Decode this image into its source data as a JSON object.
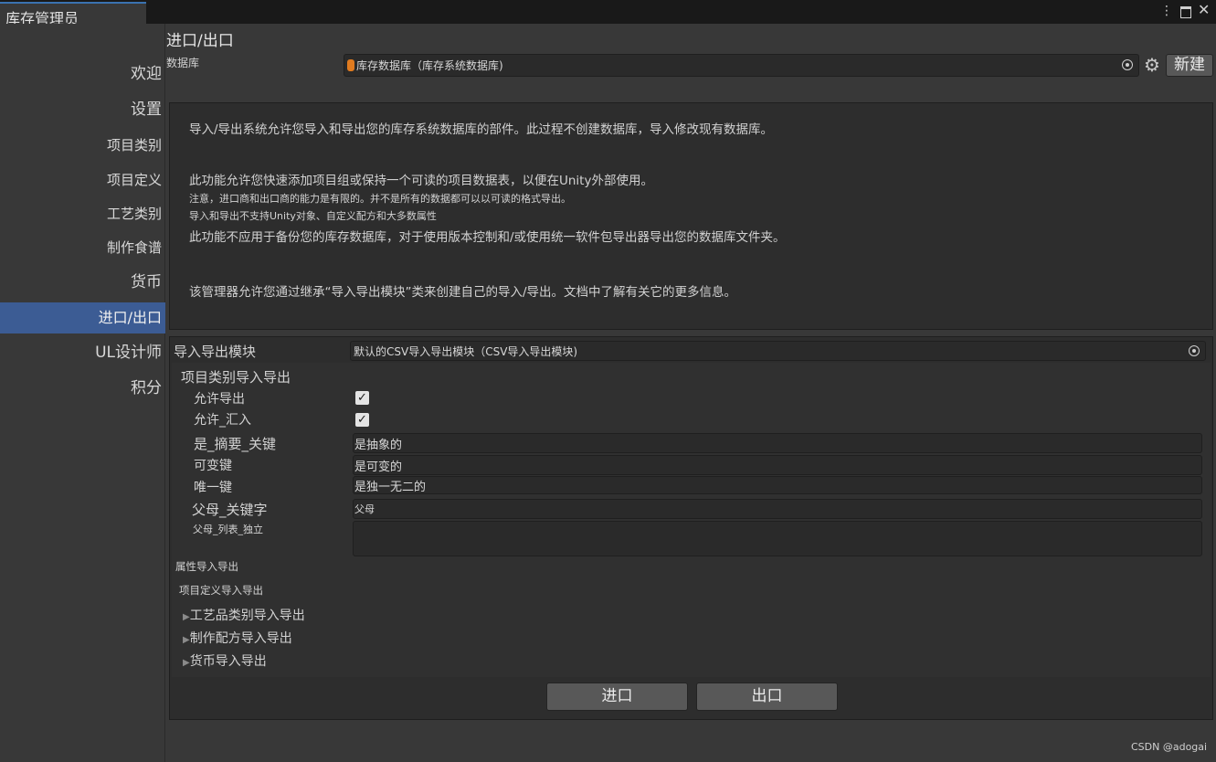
{
  "window": {
    "title": "库存管理员",
    "menu_icon": "kebab-menu-icon",
    "maximize_icon": "maximize-icon",
    "close_icon": "close-icon"
  },
  "sidebar": {
    "items": [
      {
        "label": "欢迎"
      },
      {
        "label": "设置"
      },
      {
        "label": "项目类别"
      },
      {
        "label": "项目定义"
      },
      {
        "label": "工艺类别"
      },
      {
        "label": "制作食谱"
      },
      {
        "label": "货币"
      },
      {
        "label": "进口/出口",
        "active": true
      },
      {
        "label": "UL设计师"
      },
      {
        "label": "积分"
      }
    ]
  },
  "header": {
    "title": "进口/出口",
    "database_label": "数据库",
    "database_value": "库存数据库（库存系统数据库)",
    "new_button": "新建"
  },
  "info": {
    "line1": "导入/导出系统允许您导入和导出您的库存系统数据库的部件。此过程不创建数据库，导入修改现有数据库。",
    "line2": "此功能允许您快速添加项目组或保持一个可读的项目数据表，以便在Unity外部使用。",
    "line3": "注意，进口商和出口商的能力是有限的。并不是所有的数据都可以以可读的格式导出。",
    "line4": "导入和导出不支持Unity对象、自定义配方和大多数属性",
    "line5": "此功能不应用于备份您的库存数据库，对于使用版本控制和/或使用统一软件包导出器导出您的数据库文件夹。",
    "line6": "该管理器允许您通过继承“导入导出模块”类来创建自己的导入/导出。文档中了解有关它的更多信息。"
  },
  "module": {
    "label": "导入导出模块",
    "value": "默认的CSV导入导出模块（CSV导入导出模块)"
  },
  "category_section": {
    "title": "项目类别导入导出",
    "allow_export_label": "允许导出",
    "allow_export": true,
    "allow_import_label": "允许_汇入",
    "allow_import": true,
    "fields": [
      {
        "label": "是_摘要_关键",
        "value": "是抽象的"
      },
      {
        "label": "可变键",
        "value": "是可变的"
      },
      {
        "label": "唯一键",
        "value": "是独一无二的"
      },
      {
        "label": "父母_关键字",
        "value": "父母"
      },
      {
        "label": "父母_列表_独立",
        "value": ""
      }
    ]
  },
  "sections": {
    "attribute": "属性导入导出",
    "item_definition": "项目定义导入导出",
    "collapsed": [
      "工艺品类别导入导出",
      "制作配方导入导出",
      "货币导入导出"
    ]
  },
  "buttons": {
    "import": "进口",
    "export": "出口"
  },
  "watermark": "CSDN @adogai",
  "colors": {
    "accent": "#3c5c94",
    "background": "#383838",
    "panel": "#2d2d2d",
    "field": "#2a2a2a"
  }
}
